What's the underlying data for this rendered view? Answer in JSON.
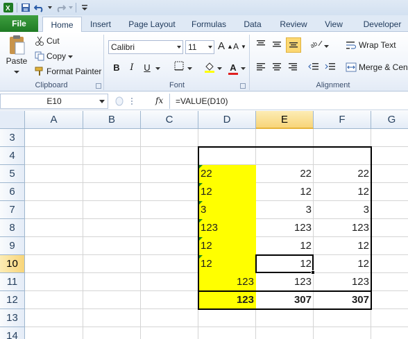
{
  "ribbon": {
    "tabs": [
      "File",
      "Home",
      "Insert",
      "Page Layout",
      "Formulas",
      "Data",
      "Review",
      "View",
      "Developer"
    ],
    "clipboard": {
      "paste": "Paste",
      "cut": "Cut",
      "copy": "Copy",
      "format_painter": "Format Painter",
      "label": "Clipboard"
    },
    "font": {
      "name": "Calibri",
      "size": "11",
      "label": "Font",
      "bold": "B",
      "italic": "I",
      "underline": "U",
      "grow": "A",
      "shrink": "A",
      "font_color": "A"
    },
    "alignment": {
      "wrap_text": "Wrap Text",
      "merge": "Merge & Cent",
      "label": "Alignment"
    }
  },
  "formula_bar": {
    "name_box": "E10",
    "fx": "fx",
    "formula": "=VALUE(D10)"
  },
  "grid": {
    "columns": [
      "A",
      "B",
      "C",
      "D",
      "E",
      "F",
      "G"
    ],
    "rows": [
      "3",
      "4",
      "5",
      "6",
      "7",
      "8",
      "9",
      "10",
      "11",
      "12",
      "13",
      "14"
    ],
    "selected_column": "E",
    "selected_row": "10",
    "cells": {
      "D5": "22",
      "E5": "22",
      "F5": "22",
      "D6": "12",
      "E6": "12",
      "F6": "12",
      "D7": "3",
      "E7": "3",
      "F7": "3",
      "D8": "123",
      "E8": "123",
      "F8": "123",
      "D9": "12",
      "E9": "12",
      "F9": "12",
      "D10": "12",
      "E10": "12",
      "F10": "12",
      "D11": "123",
      "E11": "123",
      "F11": "123",
      "D12": "123",
      "E12": "307",
      "F12": "307"
    }
  },
  "colors": {
    "highlight": "#ffff00",
    "file_tab": "#2a8c2e",
    "selection_header": "#f8d579",
    "error_indicator": "#1f8a1f"
  }
}
